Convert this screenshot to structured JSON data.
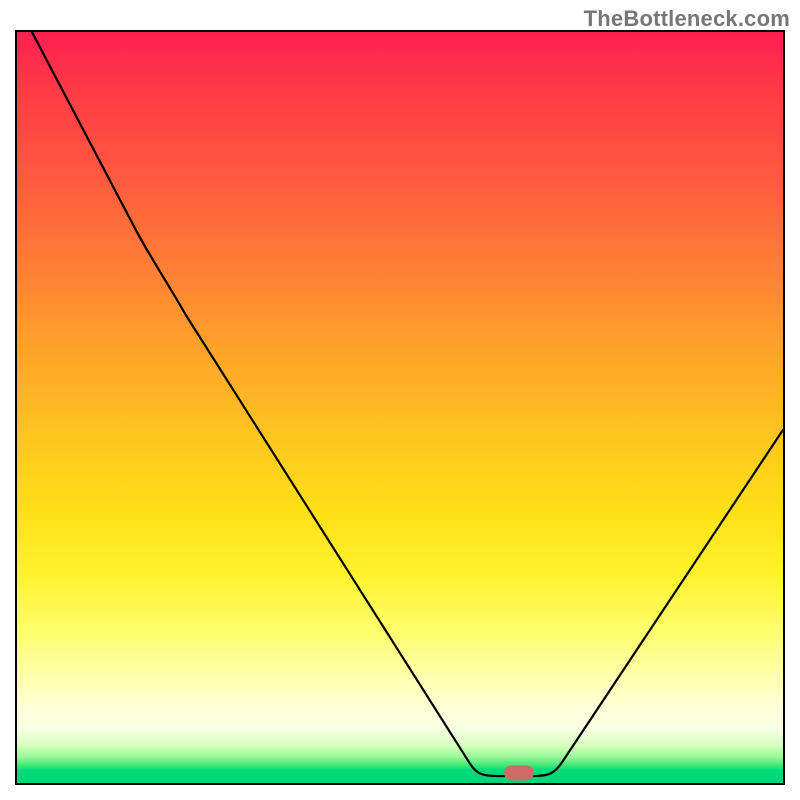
{
  "watermark": "TheBottleneck.com",
  "colors": {
    "gradient_top": "#ff1f51",
    "gradient_mid": "#ffe018",
    "gradient_bottom": "#00d47a",
    "curve": "#000000",
    "marker": "#cf6a66",
    "border": "#000000"
  },
  "chart_data": {
    "type": "line",
    "title": "",
    "xlabel": "",
    "ylabel": "",
    "xlim": [
      0,
      100
    ],
    "ylim": [
      0,
      100
    ],
    "grid": false,
    "legend": false,
    "series": [
      {
        "name": "bottleneck-curve",
        "x": [
          2,
          16,
          22,
          60,
          63,
          67,
          71,
          100
        ],
        "values": [
          100,
          74,
          62,
          3,
          1,
          1,
          3,
          47
        ]
      }
    ],
    "annotations": [
      {
        "name": "optimal-point",
        "x": 65,
        "y": 1,
        "shape": "rounded-pill",
        "color": "#cf6a66"
      }
    ],
    "background": {
      "type": "vertical-gradient",
      "stops": [
        {
          "pos": 0.0,
          "color": "#ff1f51"
        },
        {
          "pos": 0.3,
          "color": "#ff7a36"
        },
        {
          "pos": 0.55,
          "color": "#ffc61f"
        },
        {
          "pos": 0.8,
          "color": "#fffd6e"
        },
        {
          "pos": 0.93,
          "color": "#f5ffe0"
        },
        {
          "pos": 0.97,
          "color": "#4ce97a"
        },
        {
          "pos": 1.0,
          "color": "#00d47a"
        }
      ]
    }
  }
}
